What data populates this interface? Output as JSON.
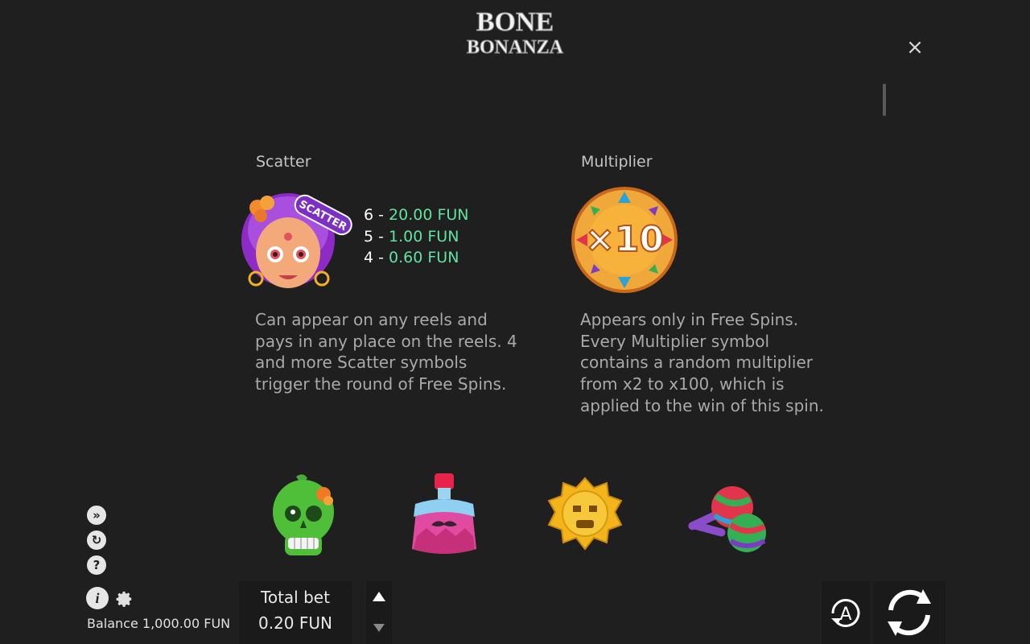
{
  "header": {
    "logo_line1": "BONE",
    "logo_line2": "BONANZA",
    "close_label": "×"
  },
  "scatter": {
    "title": "Scatter",
    "badge": "SCATTER",
    "paytable": [
      {
        "count": "6 -",
        "amount": "20.00 FUN"
      },
      {
        "count": "5 -",
        "amount": "1.00 FUN"
      },
      {
        "count": "4 -",
        "amount": "0.60 FUN"
      }
    ],
    "description_lines": [
      "Can appear on any reels and",
      "pays in any place on the reels. 4",
      "and more Scatter symbols",
      "trigger the round of Free Spins."
    ]
  },
  "multiplier": {
    "title": "Multiplier",
    "badge_text": "×10",
    "description_lines": [
      "Appears only in Free Spins.",
      "Every Multiplier symbol",
      "contains a random multiplier",
      "from x2 to x100, which is",
      "applied to the win of this spin."
    ]
  },
  "symbols": [
    "green-skull-symbol",
    "potion-bottle-symbol",
    "golden-sun-mask-symbol",
    "maracas-symbol"
  ],
  "sidebar": {
    "info_label": "i",
    "help_label": "?",
    "balance_text": "Balance 1,000.00 FUN"
  },
  "bet": {
    "label": "Total bet",
    "value": "0.20 FUN"
  },
  "controls": {
    "auto_label": "A"
  },
  "colors": {
    "background": "#1f1f1f",
    "payout_green": "#5fe39f",
    "scatter_purple": "#8e2bc6",
    "multiplier_orange": "#f39a1d"
  }
}
